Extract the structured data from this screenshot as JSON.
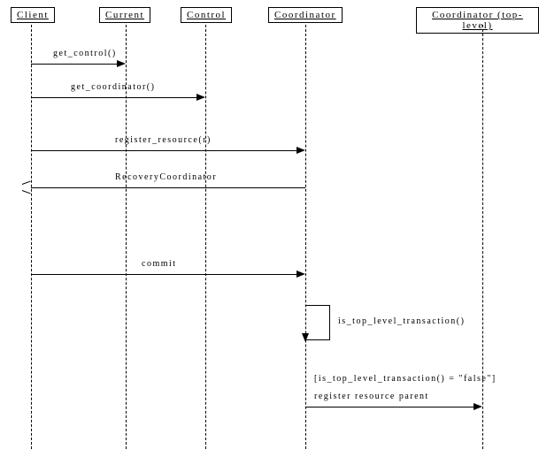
{
  "participants": {
    "client": "Client",
    "current": "Current",
    "control": "Control",
    "coordinator": "Coordinator",
    "top_coordinator": "Coordinator (top-level)"
  },
  "messages": {
    "get_control": "get_control()",
    "get_coordinator": "get_coordinator()",
    "register_resource": "register_resource(r)",
    "recovery_coordinator": "RecoveryCoordinator",
    "commit": "commit",
    "is_top_level": "is_top_level_transaction()",
    "guard": "[is_top_level_transaction() = \"false\"]",
    "register_parent": "register resource parent"
  },
  "chart_data": {
    "type": "sequence-diagram",
    "participants": [
      "Client",
      "Current",
      "Control",
      "Coordinator",
      "Coordinator (top-level)"
    ],
    "messages": [
      {
        "from": "Client",
        "to": "Current",
        "label": "get_control()",
        "kind": "call"
      },
      {
        "from": "Client",
        "to": "Control",
        "label": "get_coordinator()",
        "kind": "call"
      },
      {
        "from": "Client",
        "to": "Coordinator",
        "label": "register_resource(r)",
        "kind": "call"
      },
      {
        "from": "Coordinator",
        "to": "Client",
        "label": "RecoveryCoordinator",
        "kind": "return"
      },
      {
        "from": "Client",
        "to": "Coordinator",
        "label": "commit",
        "kind": "call"
      },
      {
        "from": "Coordinator",
        "to": "Coordinator",
        "label": "is_top_level_transaction()",
        "kind": "self"
      },
      {
        "from": "Coordinator",
        "to": "Coordinator (top-level)",
        "label": "register resource parent",
        "guard": "[is_top_level_transaction() = \"false\"]",
        "kind": "call"
      }
    ]
  }
}
